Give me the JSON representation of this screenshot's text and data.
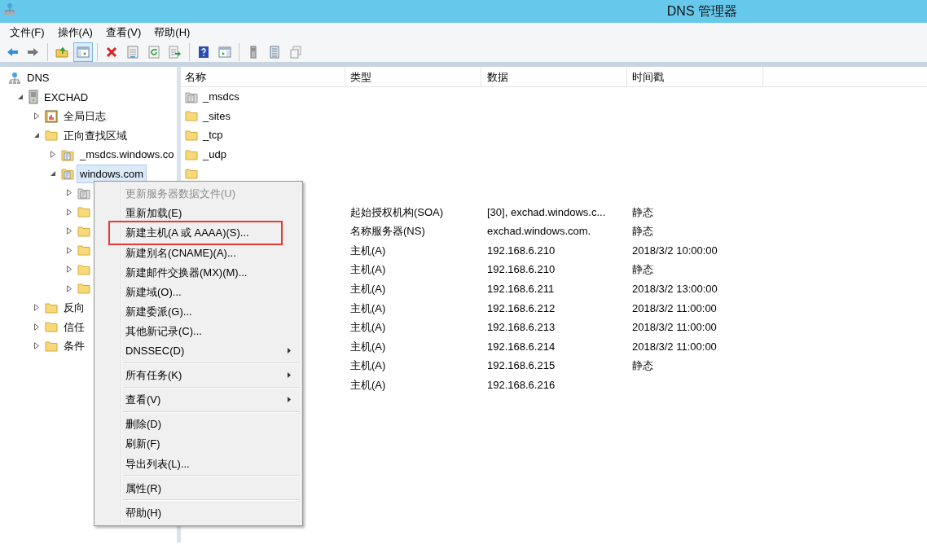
{
  "window": {
    "title": "DNS 管理器"
  },
  "menu_bar": [
    "文件(F)",
    "操作(A)",
    "查看(V)",
    "帮助(H)"
  ],
  "toolbar": [
    {
      "pressed": false
    },
    {
      "pressed": false
    },
    {
      "pressed": false
    },
    {
      "pressed": true
    },
    {
      "pressed": false
    },
    {
      "pressed": false
    },
    {
      "pressed": false
    },
    {
      "pressed": false
    },
    {
      "pressed": false
    },
    {
      "pressed": false
    },
    {
      "pressed": false
    },
    {
      "pressed": false
    },
    {
      "pressed": false
    }
  ],
  "tree": [
    {
      "label": "DNS",
      "kind": "root",
      "selected": false,
      "children": [
        {
          "label": "EXCHAD",
          "kind": "server",
          "expanded": true,
          "selected": false,
          "children": [
            {
              "label": "全局日志",
              "kind": "log",
              "expanded": false,
              "selected": false
            },
            {
              "label": "正向查找区域",
              "kind": "folder",
              "expanded": true,
              "selected": false,
              "children": [
                {
                  "label": "_msdcs.windows.co",
                  "kind": "zone",
                  "expanded": false,
                  "selected": false
                },
                {
                  "label": "windows.com",
                  "kind": "zone",
                  "expanded": true,
                  "selected": true,
                  "children": [
                    {
                      "kind": "zone-grey",
                      "expanded": false
                    },
                    {
                      "kind": "folder",
                      "expanded": false
                    },
                    {
                      "kind": "folder",
                      "expanded": false
                    },
                    {
                      "kind": "folder",
                      "expanded": false
                    },
                    {
                      "kind": "folder",
                      "expanded": false
                    },
                    {
                      "kind": "folder",
                      "expanded": false
                    }
                  ]
                }
              ]
            },
            {
              "label": "反向",
              "kind": "folder",
              "expanded": false,
              "selected": false
            },
            {
              "label": "信任",
              "kind": "folder",
              "expanded": false,
              "selected": false
            },
            {
              "label": "条件",
              "kind": "folder",
              "expanded": false,
              "selected": false
            }
          ]
        }
      ]
    }
  ],
  "table": {
    "columns": [
      "名称",
      "类型",
      "数据",
      "时间戳"
    ],
    "rows": [
      {
        "kind": "zone-grey",
        "name": "_msdcs"
      },
      {
        "kind": "folder",
        "name": "_sites"
      },
      {
        "kind": "folder",
        "name": "_tcp"
      },
      {
        "kind": "folder",
        "name": "_udp"
      },
      {
        "kind": "folder"
      },
      {
        "kind": "none"
      },
      {
        "kind": "none",
        "type": "起始授权机构(SOA)",
        "data": "[30], exchad.windows.c...",
        "timestamp": "静态"
      },
      {
        "kind": "none",
        "type": "名称服务器(NS)",
        "data": "exchad.windows.com.",
        "timestamp": "静态"
      },
      {
        "kind": "none",
        "type": "主机(A)",
        "data": "192.168.6.210",
        "timestamp": "2018/3/2 10:00:00"
      },
      {
        "kind": "none",
        "type": "主机(A)",
        "data": "192.168.6.210",
        "timestamp": "静态"
      },
      {
        "kind": "none",
        "type": "主机(A)",
        "data": "192.168.6.211",
        "timestamp": "2018/3/2 13:00:00"
      },
      {
        "kind": "none",
        "type": "主机(A)",
        "data": "192.168.6.212",
        "timestamp": "2018/3/2 11:00:00"
      },
      {
        "kind": "none",
        "type": "主机(A)",
        "data": "192.168.6.213",
        "timestamp": "2018/3/2 11:00:00"
      },
      {
        "kind": "none",
        "type": "主机(A)",
        "data": "192.168.6.214",
        "timestamp": "2018/3/2 11:00:00"
      },
      {
        "kind": "none",
        "type": "主机(A)",
        "data": "192.168.6.215",
        "timestamp": "静态"
      },
      {
        "kind": "none",
        "type": "主机(A)",
        "data": "192.168.6.216"
      }
    ]
  },
  "context_menu": [
    {
      "kind": "item",
      "label": "更新服务器数据文件(U)",
      "disabled": true,
      "submenu": false,
      "highlighted": false
    },
    {
      "kind": "item",
      "label": "重新加载(E)",
      "disabled": false,
      "submenu": false,
      "highlighted": false
    },
    {
      "kind": "item",
      "label": "新建主机(A 或 AAAA)(S)...",
      "disabled": false,
      "submenu": false,
      "highlighted": true
    },
    {
      "kind": "item",
      "label": "新建别名(CNAME)(A)...",
      "disabled": false,
      "submenu": false,
      "highlighted": false
    },
    {
      "kind": "item",
      "label": "新建邮件交换器(MX)(M)...",
      "disabled": false,
      "submenu": false,
      "highlighted": false
    },
    {
      "kind": "item",
      "label": "新建域(O)...",
      "disabled": false,
      "submenu": false,
      "highlighted": false
    },
    {
      "kind": "item",
      "label": "新建委派(G)...",
      "disabled": false,
      "submenu": false,
      "highlighted": false
    },
    {
      "kind": "item",
      "label": "其他新记录(C)...",
      "disabled": false,
      "submenu": false,
      "highlighted": false
    },
    {
      "kind": "item",
      "label": "DNSSEC(D)",
      "disabled": false,
      "submenu": true,
      "highlighted": false
    },
    {
      "kind": "separator"
    },
    {
      "kind": "item",
      "label": "所有任务(K)",
      "disabled": false,
      "submenu": true,
      "highlighted": false
    },
    {
      "kind": "separator"
    },
    {
      "kind": "item",
      "label": "查看(V)",
      "disabled": false,
      "submenu": true,
      "highlighted": false
    },
    {
      "kind": "separator"
    },
    {
      "kind": "item",
      "label": "删除(D)",
      "disabled": false,
      "submenu": false,
      "highlighted": false
    },
    {
      "kind": "item",
      "label": "刷新(F)",
      "disabled": false,
      "submenu": false,
      "highlighted": false
    },
    {
      "kind": "item",
      "label": "导出列表(L)...",
      "disabled": false,
      "submenu": false,
      "highlighted": false
    },
    {
      "kind": "separator"
    },
    {
      "kind": "item",
      "label": "属性(R)",
      "disabled": false,
      "submenu": false,
      "highlighted": false
    },
    {
      "kind": "separator"
    },
    {
      "kind": "item",
      "label": "帮助(H)",
      "disabled": false,
      "submenu": false,
      "highlighted": false
    }
  ]
}
